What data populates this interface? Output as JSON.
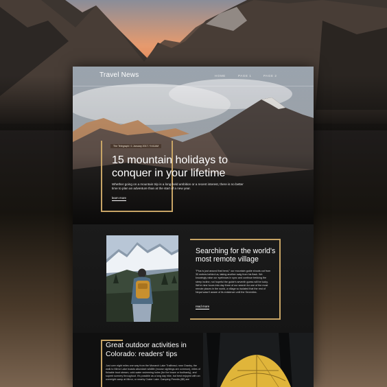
{
  "site": {
    "logo": "Travel News",
    "nav": [
      "HOME",
      "PAGE 1",
      "PAGE 2"
    ]
  },
  "hero": {
    "meta": "The Telegraph / 1 January 2017 / 9:41AM",
    "title": "15 mountain holidays to conquer in your lifetime",
    "description": "Whether going on a mountain trip is a long-held ambition or a recent interest, there is no better time to plan an adventure than at the start of a new year.",
    "cta": "learn more"
  },
  "feature": {
    "title": "Searching for the world's most remote village",
    "body": "\"Plus is just around that bend,\" our mountain guide shouts out from 30 metres behind us, taking another swig from his flask. We knowingly raise our eyebrows in sync and continue trekking the steep incline, not hopeful the guide's seventh guess will be lucky. We're nine hours into day three of our search for one of the most remote places in the world, a village so isolated that the rest of Nepal wasn't aware of its existence until the Seventies.",
    "cta": "read more"
  },
  "outdoor": {
    "title": "Great outdoor activities in Colorado: readers' tips",
    "body": "Just over eight miles one way from the Monarch Lake Trailhead, near Granby, the walk to Mirror Lake boasts abundant wildlife (moose sightings are common), miles of fishable trout stream, cold-water swimming holes (for the brave or foolhardy), and superb scenery throughout. It's possible as a long day hike, but best enjoyed with an overnight camp at Mirror, or nearby Crater Lake. Camping Permits ($5) are"
  },
  "colors": {
    "accent": "#c8a566",
    "background": "#151515",
    "text": "#ffffff"
  }
}
